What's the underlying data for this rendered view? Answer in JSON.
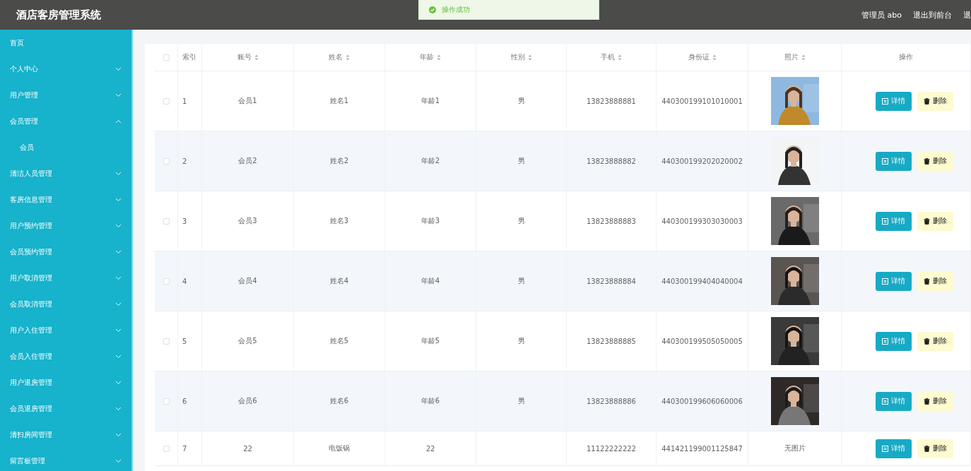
{
  "header": {
    "title": "酒店客房管理系统",
    "user": "管理员 abo",
    "links": [
      "退出到前台",
      "退"
    ]
  },
  "toast": {
    "text": "操作成功"
  },
  "sidebar": {
    "items": [
      {
        "label": "首页"
      },
      {
        "label": "个人中心",
        "expanded": false
      },
      {
        "label": "用户管理",
        "expanded": false
      },
      {
        "label": "会员管理",
        "expanded": true,
        "children": [
          {
            "label": "会员"
          }
        ]
      },
      {
        "label": "清洁人员管理",
        "expanded": false
      },
      {
        "label": "客房信息管理",
        "expanded": false
      },
      {
        "label": "用户预约管理",
        "expanded": false
      },
      {
        "label": "会员预约管理",
        "expanded": false
      },
      {
        "label": "用户取消管理",
        "expanded": false
      },
      {
        "label": "会员取消管理",
        "expanded": false
      },
      {
        "label": "用户入住管理",
        "expanded": false
      },
      {
        "label": "会员入住管理",
        "expanded": false
      },
      {
        "label": "用户退房管理",
        "expanded": false
      },
      {
        "label": "会员退房管理",
        "expanded": false
      },
      {
        "label": "清扫房间管理",
        "expanded": false
      },
      {
        "label": "留言板管理",
        "expanded": false
      }
    ]
  },
  "table": {
    "select_all_checked": false,
    "columns": [
      {
        "label": "索引",
        "sortable": false
      },
      {
        "label": "账号",
        "sortable": true
      },
      {
        "label": "姓名",
        "sortable": true
      },
      {
        "label": "年龄",
        "sortable": true
      },
      {
        "label": "性别",
        "sortable": true
      },
      {
        "label": "手机",
        "sortable": true
      },
      {
        "label": "身份证",
        "sortable": true
      },
      {
        "label": "照片",
        "sortable": true
      },
      {
        "label": "操作",
        "sortable": false
      }
    ],
    "rows": [
      {
        "checked": false,
        "index": "1",
        "account": "会员1",
        "name": "姓名1",
        "age": "年龄1",
        "gender": "男",
        "phone": "13823888881",
        "id_card": "440300199101010001",
        "actions": [
          "详情",
          "删除"
        ]
      },
      {
        "checked": false,
        "index": "2",
        "account": "会员2",
        "name": "姓名2",
        "age": "年龄2",
        "gender": "男",
        "phone": "13823888882",
        "id_card": "440300199202020002",
        "actions": [
          "详情",
          "删除"
        ]
      },
      {
        "checked": false,
        "index": "3",
        "account": "会员3",
        "name": "姓名3",
        "age": "年龄3",
        "gender": "男",
        "phone": "13823888883",
        "id_card": "440300199303030003",
        "actions": [
          "详情",
          "删除"
        ]
      },
      {
        "checked": false,
        "index": "4",
        "account": "会员4",
        "name": "姓名4",
        "age": "年龄4",
        "gender": "男",
        "phone": "13823888884",
        "id_card": "440300199404040004",
        "actions": [
          "详情",
          "删除"
        ]
      },
      {
        "checked": false,
        "index": "5",
        "account": "会员5",
        "name": "姓名5",
        "age": "年龄5",
        "gender": "男",
        "phone": "13823888885",
        "id_card": "440300199505050005",
        "actions": [
          "详情",
          "删除"
        ]
      },
      {
        "checked": false,
        "index": "6",
        "account": "会员6",
        "name": "姓名6",
        "age": "年龄6",
        "gender": "男",
        "phone": "13823888886",
        "id_card": "440300199606060006",
        "actions": [
          "详情",
          "删除"
        ]
      },
      {
        "checked": false,
        "index": "7",
        "account": "22",
        "name": "电饭锅",
        "age": "22",
        "phone": "11122222222",
        "id_card": "441421199001125847",
        "photo": {
          "kind": "text",
          "text": "无图片"
        },
        "actions": [
          "详情",
          "删除"
        ]
      }
    ]
  }
}
